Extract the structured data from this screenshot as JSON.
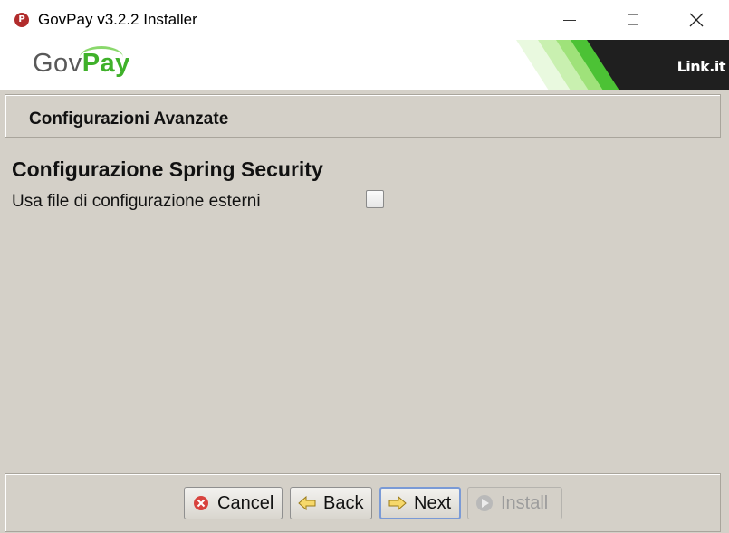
{
  "window": {
    "title": "GovPay v3.2.2 Installer",
    "controls": {
      "minimize": "minimize-icon",
      "maximize": "maximize-icon",
      "close": "close-icon"
    }
  },
  "banner": {
    "logo_gov": "Gov",
    "logo_pay": "Pay",
    "brand_right": "Link.it",
    "colors": {
      "green_dark": "#3fb12a",
      "green_light": "#b9ee9b",
      "dark": "#1f1f1f"
    }
  },
  "header": {
    "title": "Configurazioni Avanzate"
  },
  "content": {
    "section_title": "Configurazione Spring Security",
    "option_label": "Usa file di configurazione esterni",
    "option_checked": false
  },
  "footer": {
    "cancel": "Cancel",
    "back": "Back",
    "next": "Next",
    "install": "Install"
  }
}
